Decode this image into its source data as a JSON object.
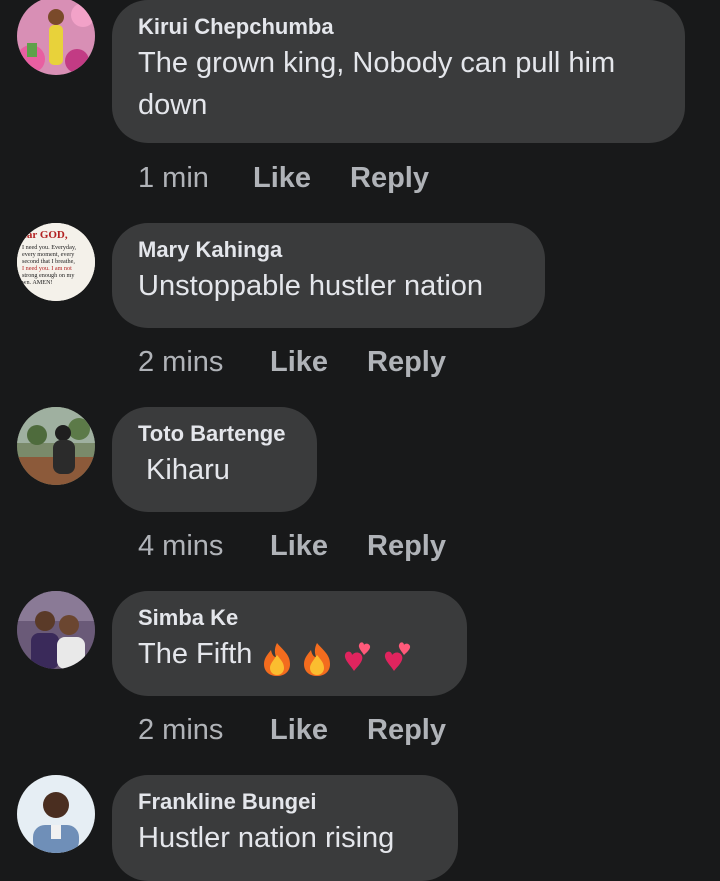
{
  "comments": [
    {
      "author": "Kirui Chepchumba",
      "text": "The grown king, Nobody can pull him down",
      "time": "1 min",
      "like": "Like",
      "reply": "Reply",
      "avatar_icon": "profile-photo"
    },
    {
      "author": "Mary Kahinga",
      "text": "Unstoppable hustler nation",
      "time": "2 mins",
      "like": "Like",
      "reply": "Reply",
      "avatar_icon": "prayer-text-photo",
      "avatar_lines": [
        "ear GOD,",
        "I need you. Everyday,",
        "every moment, every",
        "second that I breathe,",
        "I need you. I am not",
        "strong enough on my",
        "wn. AMEN!"
      ]
    },
    {
      "author": "Toto Bartenge",
      "text": " Kiharu",
      "time": "4 mins",
      "like": "Like",
      "reply": "Reply",
      "avatar_icon": "profile-photo"
    },
    {
      "author": "Simba Ke",
      "text": "The Fifth",
      "emojis": [
        "fire-emoji",
        "fire-emoji",
        "two-hearts-emoji",
        "two-hearts-emoji"
      ],
      "time": "2 mins",
      "like": "Like",
      "reply": "Reply",
      "avatar_icon": "profile-photo"
    },
    {
      "author": "Frankline Bungei",
      "text": "Hustler nation rising",
      "avatar_icon": "profile-photo"
    }
  ],
  "colors": {
    "background": "#18191a",
    "bubble": "#3a3b3c",
    "primary_text": "#e4e6eb",
    "secondary_text": "#b0b3b8"
  }
}
